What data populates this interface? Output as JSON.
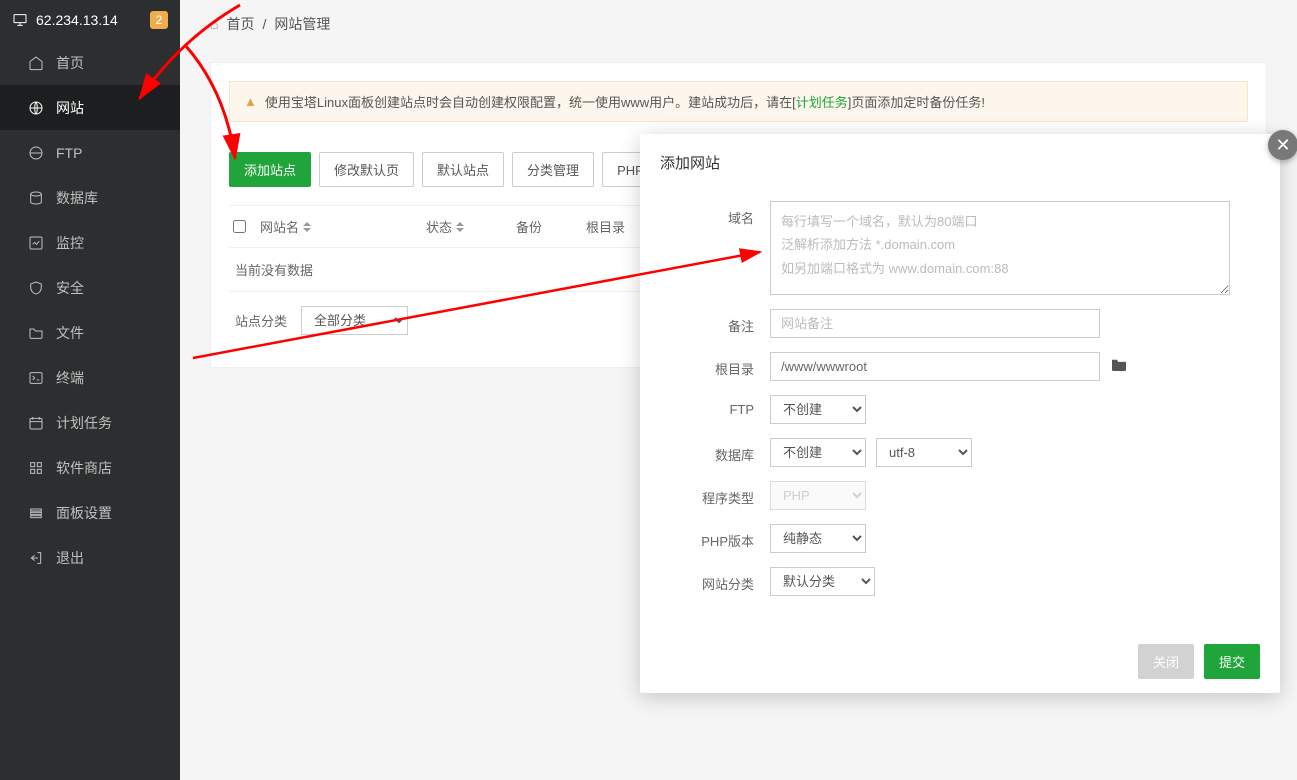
{
  "header": {
    "ip": "62.234.13.14",
    "badge": "2"
  },
  "sidebar": {
    "items": [
      {
        "label": "首页",
        "icon": "home"
      },
      {
        "label": "网站",
        "icon": "globe"
      },
      {
        "label": "FTP",
        "icon": "globe"
      },
      {
        "label": "数据库",
        "icon": "database"
      },
      {
        "label": "监控",
        "icon": "monitor"
      },
      {
        "label": "安全",
        "icon": "shield"
      },
      {
        "label": "文件",
        "icon": "folder"
      },
      {
        "label": "终端",
        "icon": "terminal"
      },
      {
        "label": "计划任务",
        "icon": "clock"
      },
      {
        "label": "软件商店",
        "icon": "grid"
      },
      {
        "label": "面板设置",
        "icon": "settings"
      },
      {
        "label": "退出",
        "icon": "logout"
      }
    ]
  },
  "breadcrumb": {
    "home": "首页",
    "current": "网站管理"
  },
  "alert": {
    "pre": "使用宝塔Linux面板创建站点时会自动创建权限配置，统一使用www用户。建站成功后，请在[",
    "link": "计划任务",
    "post": "]页面添加定时备份任务!"
  },
  "toolbar": {
    "add": "添加站点",
    "default_page": "修改默认页",
    "default_site": "默认站点",
    "category": "分类管理",
    "php_cli": "PHP命令行版本"
  },
  "table": {
    "cols": {
      "name": "网站名",
      "status": "状态",
      "backup": "备份",
      "root": "根目录"
    },
    "no_data": "当前没有数据"
  },
  "filter": {
    "label": "站点分类",
    "value": "全部分类"
  },
  "modal": {
    "title": "添加网站",
    "labels": {
      "domain": "域名",
      "note": "备注",
      "root": "根目录",
      "ftp": "FTP",
      "db": "数据库",
      "ptype": "程序类型",
      "phpv": "PHP版本",
      "sitecat": "网站分类"
    },
    "placeholders": {
      "domain": "每行填写一个域名，默认为80端口\n泛解析添加方法 *.domain.com\n如另加端口格式为 www.domain.com:88",
      "note": "网站备注"
    },
    "values": {
      "root": "/www/wwwroot",
      "ftp": "不创建",
      "db": "不创建",
      "db_charset": "utf-8",
      "ptype": "PHP",
      "phpv": "纯静态",
      "sitecat": "默认分类"
    },
    "buttons": {
      "close": "关闭",
      "submit": "提交"
    }
  }
}
